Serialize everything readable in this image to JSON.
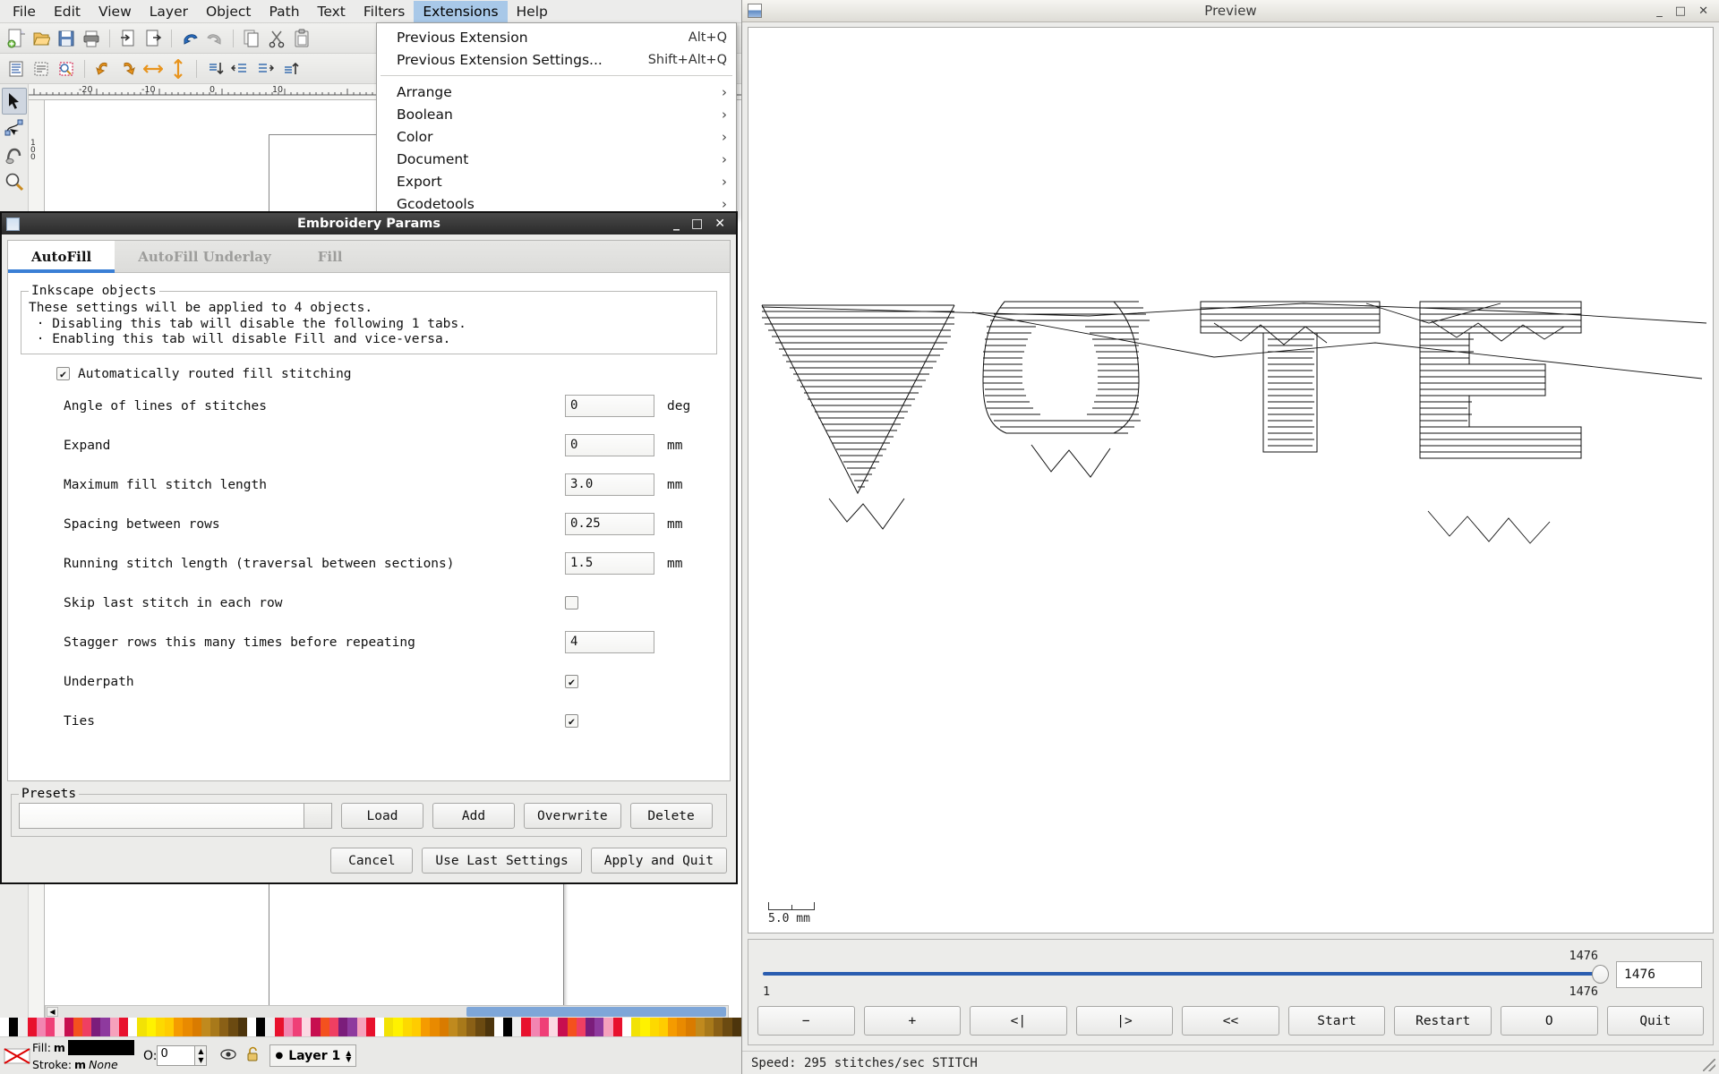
{
  "inkscape": {
    "menubar": [
      {
        "label": "File",
        "mnemonic": "F"
      },
      {
        "label": "Edit",
        "mnemonic": "E"
      },
      {
        "label": "View",
        "mnemonic": "V"
      },
      {
        "label": "Layer",
        "mnemonic": "L"
      },
      {
        "label": "Object",
        "mnemonic": "O"
      },
      {
        "label": "Path",
        "mnemonic": "P"
      },
      {
        "label": "Text",
        "mnemonic": "T"
      },
      {
        "label": "Filters",
        "mnemonic": "s"
      },
      {
        "label": "Extensions",
        "mnemonic": "n",
        "active": true
      },
      {
        "label": "Help",
        "mnemonic": "H"
      }
    ],
    "toolbar_main": [
      "new-document-icon",
      "open-document-icon",
      "save-document-icon",
      "print-icon",
      "import-icon",
      "export-icon",
      "undo-icon",
      "redo-icon",
      "copy-icon",
      "cut-icon",
      "paste-icon"
    ],
    "toolbar_commands": [
      "object-properties-icon",
      "xml-editor-icon",
      "object-align-icon",
      "rotate-ccw-icon",
      "rotate-cw-icon",
      "flip-horizontal-icon",
      "flip-vertical-icon",
      "raise-to-top-icon",
      "lower-icon",
      "raise-icon",
      "lower-to-bottom-icon"
    ],
    "tools": [
      {
        "name": "selector-tool",
        "selected": true
      },
      {
        "name": "node-editor-tool",
        "selected": false
      },
      {
        "name": "tweak-tool",
        "selected": false
      },
      {
        "name": "zoom-tool",
        "selected": false
      }
    ],
    "ruler": {
      "h_ticks": [
        "-20",
        "-10",
        "0",
        "10"
      ],
      "v_ticks": [
        "100",
        "0"
      ]
    },
    "statusbar": {
      "fill_label": "Fill:",
      "stroke_label": "Stroke:",
      "fill_marker": "m",
      "stroke_marker": "m",
      "stroke_value": "None",
      "opacity_label": "O:",
      "opacity_value": "0",
      "layer_name": "Layer 1",
      "eye_icon": "visibility-icon",
      "lock_icon": "unlock-icon"
    },
    "palette_colors": [
      "#ffffff",
      "#000000",
      "#eeeeee",
      "#e8112d",
      "#f285b1",
      "#ef3f77",
      "#fbd9e3",
      "#c70e4f",
      "#f4511e",
      "#ef3f62",
      "#7b1d7b",
      "#8e3a9e",
      "#f6a1bc",
      "#e8112d",
      "#ffffff",
      "#f2e205",
      "#fff200",
      "#fdd900",
      "#ffcc00",
      "#f59b00",
      "#e98a00",
      "#d97b00",
      "#c08a1e",
      "#a8791a",
      "#8a6016",
      "#6b4a11",
      "#4d350c"
    ]
  },
  "extensions_menu": {
    "items": [
      {
        "label": "Previous Extension",
        "accel": "Alt+Q",
        "submenu": false,
        "mnemonic": "n"
      },
      {
        "label": "Previous Extension Settings...",
        "accel": "Shift+Alt+Q",
        "submenu": false,
        "mnemonic": "P"
      },
      {
        "separator": true
      },
      {
        "label": "Arrange",
        "accel": "",
        "submenu": true
      },
      {
        "label": "Boolean",
        "accel": "",
        "submenu": true
      },
      {
        "label": "Color",
        "accel": "",
        "submenu": true
      },
      {
        "label": "Document",
        "accel": "",
        "submenu": true
      },
      {
        "label": "Export",
        "accel": "",
        "submenu": true
      },
      {
        "label": "Gcodetools",
        "accel": "",
        "submenu": true
      }
    ]
  },
  "dialog": {
    "title": "Embroidery Params",
    "titlebar_buttons": [
      "minimize",
      "maximize",
      "close"
    ],
    "tabs": [
      {
        "label": "AutoFill",
        "active": true
      },
      {
        "label": "AutoFill Underlay",
        "active": false
      },
      {
        "label": "Fill",
        "active": false
      }
    ],
    "group": {
      "legend": "Inkscape objects",
      "lines": [
        "These settings will be applied to 4 objects.",
        " · Disabling this tab will disable the following 1 tabs.",
        " · Enabling this tab will disable Fill and vice-versa."
      ]
    },
    "enable_checkbox": {
      "label": "Automatically routed fill stitching",
      "checked": true
    },
    "fields": [
      {
        "label": "Angle of lines of stitches",
        "type": "text",
        "value": "0",
        "unit": "deg"
      },
      {
        "label": "Expand",
        "type": "text",
        "value": "0",
        "unit": "mm"
      },
      {
        "label": "Maximum fill stitch length",
        "type": "text",
        "value": "3.0",
        "unit": "mm"
      },
      {
        "label": "Spacing between rows",
        "type": "text",
        "value": "0.25",
        "unit": "mm"
      },
      {
        "label": "Running stitch length (traversal between sections)",
        "type": "text",
        "value": "1.5",
        "unit": "mm"
      },
      {
        "label": "Skip last stitch in each row",
        "type": "checkbox",
        "checked": false,
        "unit": ""
      },
      {
        "label": "Stagger rows this many times before repeating",
        "type": "text",
        "value": "4",
        "unit": ""
      },
      {
        "label": "Underpath",
        "type": "checkbox",
        "checked": true,
        "unit": ""
      },
      {
        "label": "Ties",
        "type": "checkbox",
        "checked": true,
        "unit": ""
      }
    ],
    "presets": {
      "legend": "Presets",
      "input_value": "",
      "input_placeholder": "",
      "buttons": [
        "Load",
        "Add",
        "Overwrite",
        "Delete"
      ]
    },
    "actions": [
      "Cancel",
      "Use Last Settings",
      "Apply and Quit"
    ]
  },
  "preview": {
    "title": "Preview",
    "titlebar_buttons": [
      "minimize",
      "maximize",
      "close"
    ],
    "scale_label": "5.0 mm",
    "slider": {
      "min_label": "1",
      "max_label_top": "1476",
      "max_label_bottom": "1476",
      "value": "1476"
    },
    "buttons": [
      "−",
      "+",
      "<|",
      "|>",
      "<<",
      "Start",
      "Restart",
      "O",
      "Quit"
    ],
    "status": "Speed: 295 stitches/sec  STITCH",
    "artwork_text": "VOTE"
  }
}
